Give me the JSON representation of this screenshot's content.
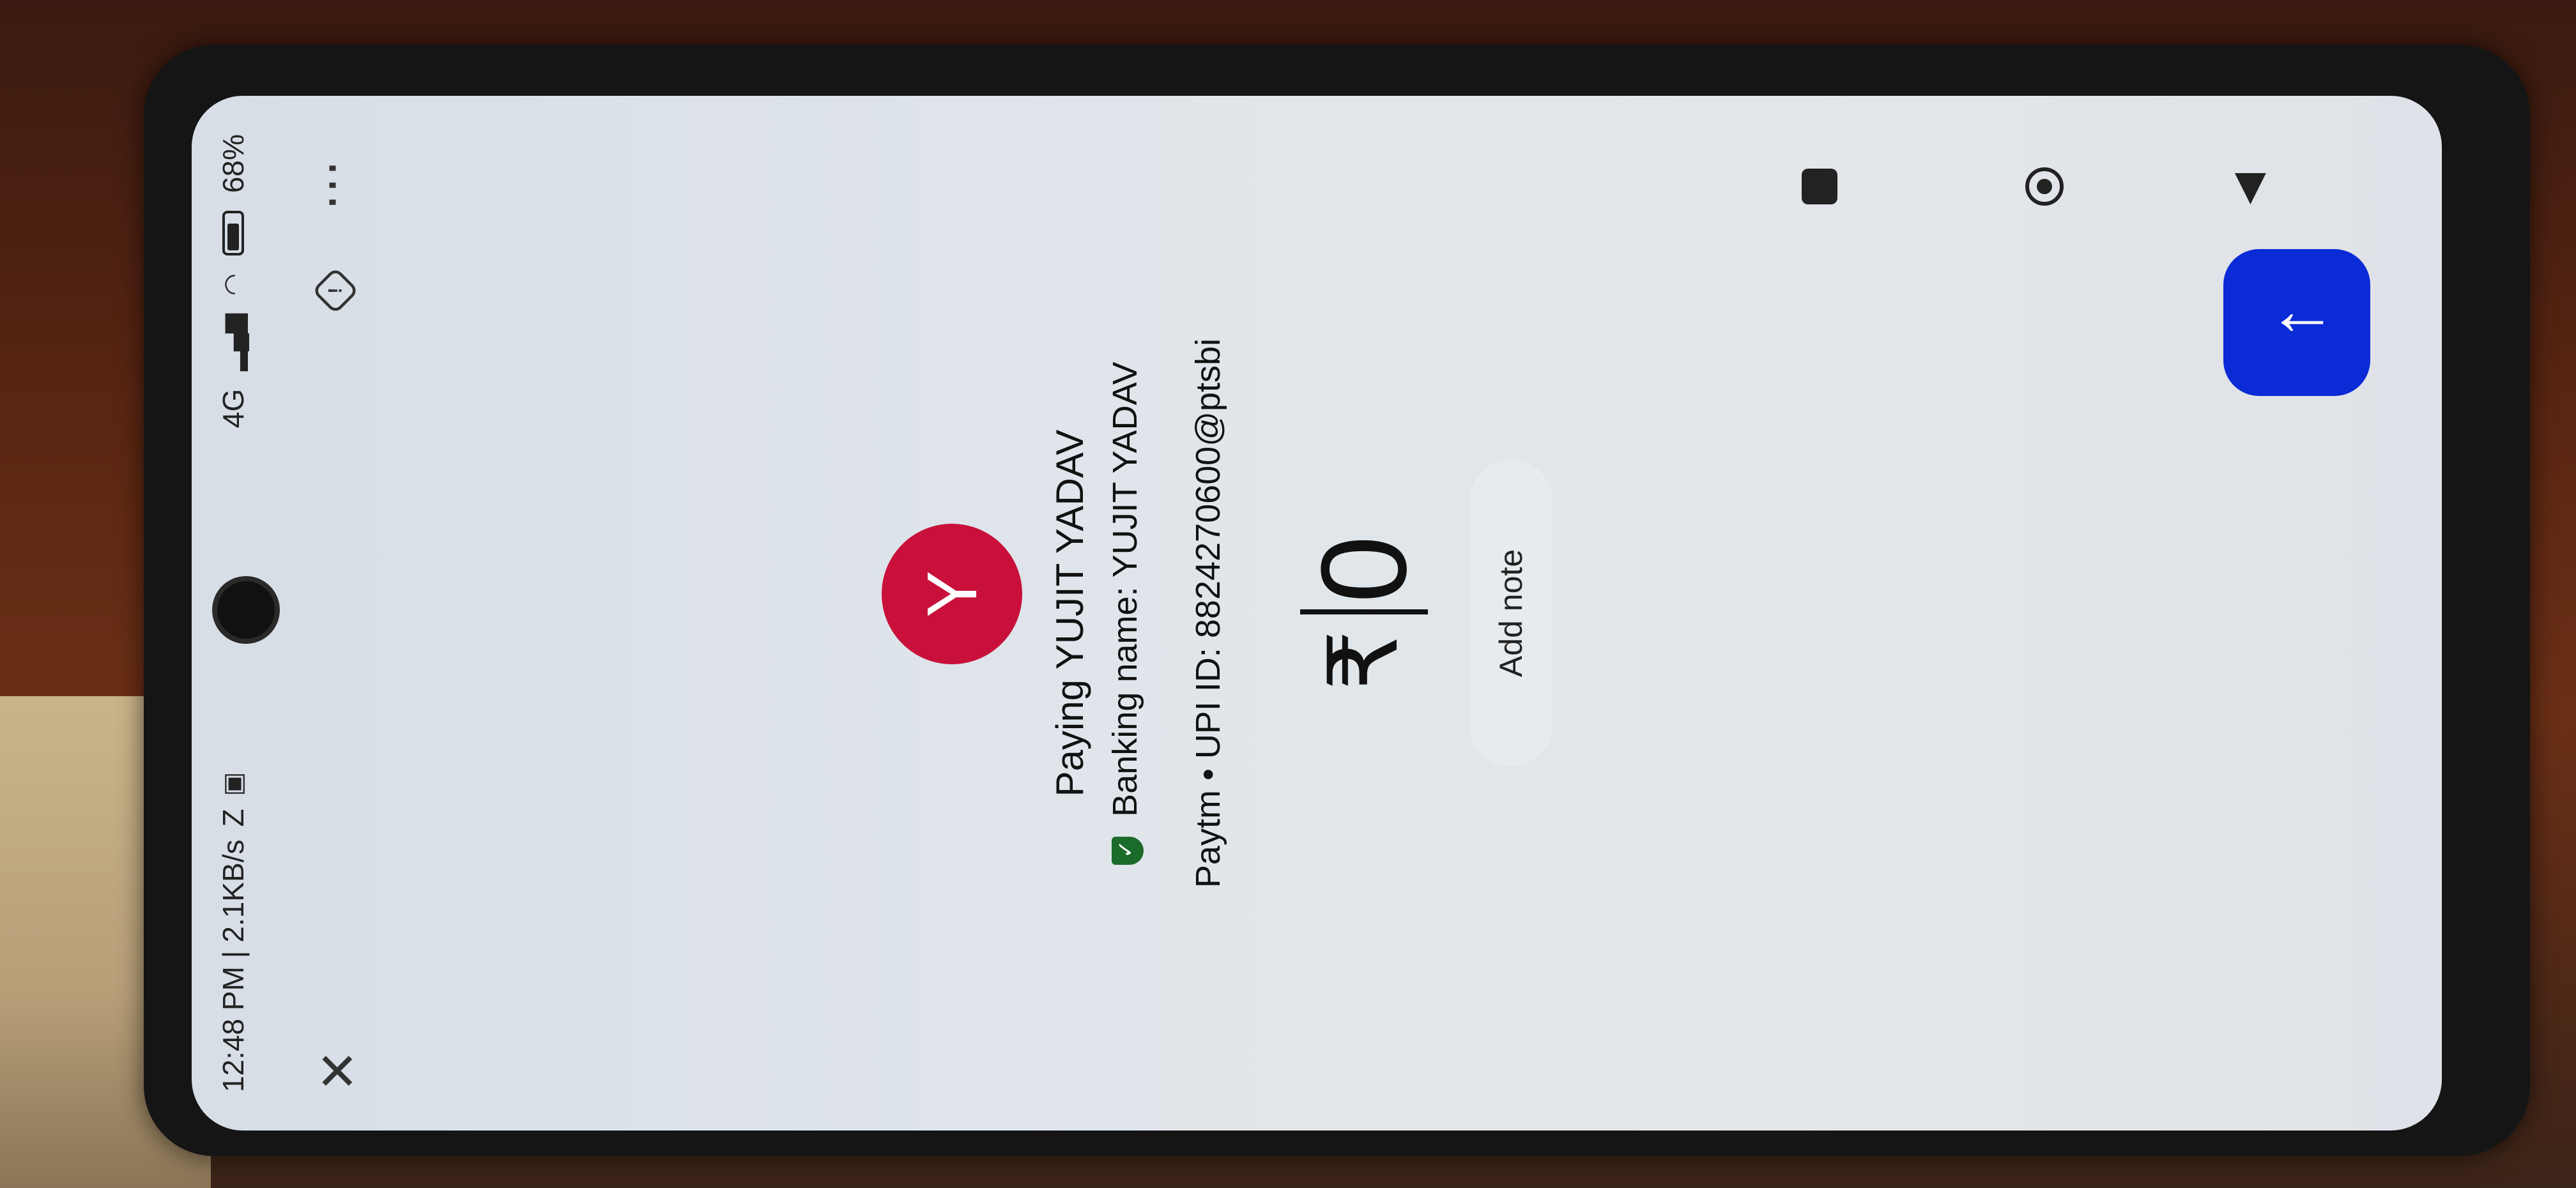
{
  "status_bar": {
    "time": "12:48 PM | 2.1KB/s",
    "extra_glyph": "Z",
    "network": "4G",
    "battery_percent": "68%"
  },
  "topbar": {
    "close_glyph": "✕",
    "report_glyph": "!",
    "more_glyph": "⋯"
  },
  "payee": {
    "avatar_letter": "Y",
    "paying_text": "Paying YUJIT  YADAV",
    "banking_name": "Banking name: YUJIT  YADAV",
    "upi_line": "Paytm • UPI ID: 8824270600@ptsbi"
  },
  "amount": {
    "currency": "₹",
    "value": "0"
  },
  "add_note_label": "Add note",
  "send_glyph": "↑",
  "colors": {
    "avatar": "#c8103a",
    "fab": "#0a2bd6",
    "verified_shield": "#1b6b2a"
  }
}
